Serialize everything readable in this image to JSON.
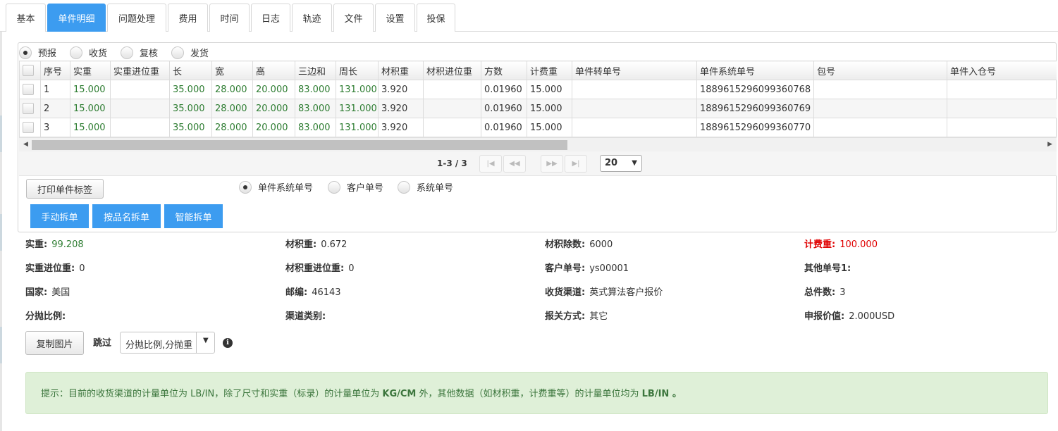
{
  "tabs": [
    "基本",
    "单件明细",
    "问题处理",
    "费用",
    "时间",
    "日志",
    "轨迹",
    "文件",
    "设置",
    "投保"
  ],
  "status_radios": [
    {
      "label": "预报",
      "checked": true
    },
    {
      "label": "收货",
      "checked": false
    },
    {
      "label": "复核",
      "checked": false
    },
    {
      "label": "发货",
      "checked": false
    }
  ],
  "table": {
    "columns": [
      "序号",
      "实重",
      "实重进位重",
      "长",
      "宽",
      "高",
      "三边和",
      "周长",
      "材积重",
      "材积进位重",
      "方数",
      "计费重",
      "单件转单号",
      "单件系统单号",
      "包号",
      "单件入仓号"
    ],
    "rows": [
      [
        "1",
        "15.000",
        "",
        "35.000",
        "28.000",
        "20.000",
        "83.000",
        "131.000",
        "3.920",
        "",
        "0.01960",
        "15.000",
        "",
        "1889615296099360768",
        "",
        ""
      ],
      [
        "2",
        "15.000",
        "",
        "35.000",
        "28.000",
        "20.000",
        "83.000",
        "131.000",
        "3.920",
        "",
        "0.01960",
        "15.000",
        "",
        "1889615296099360769",
        "",
        ""
      ],
      [
        "3",
        "15.000",
        "",
        "35.000",
        "28.000",
        "20.000",
        "83.000",
        "131.000",
        "3.920",
        "",
        "0.01960",
        "15.000",
        "",
        "1889615296099360770",
        "",
        ""
      ]
    ]
  },
  "pager": {
    "info": "1-3 / 3",
    "buttons": [
      "first",
      "prev",
      "next",
      "last"
    ],
    "page_size": "20"
  },
  "print_label_button": "打印单件标签",
  "label_type_radios": [
    {
      "label": "单件系统单号",
      "checked": true
    },
    {
      "label": "客户单号",
      "checked": false
    },
    {
      "label": "系统单号",
      "checked": false
    }
  ],
  "split_buttons": [
    "手动拆单",
    "按品名拆单",
    "智能拆单"
  ],
  "fields": [
    {
      "key": "实重:",
      "value": "99.208",
      "style": "green"
    },
    {
      "key": "材积重:",
      "value": "0.672",
      "style": ""
    },
    {
      "key": "材积除数:",
      "value": "6000",
      "style": ""
    },
    {
      "key": "计费重:",
      "value": "100.000",
      "style": "red"
    },
    {
      "key": "实重进位重:",
      "value": "0",
      "style": ""
    },
    {
      "key": "材积重进位重:",
      "value": "0",
      "style": ""
    },
    {
      "key": "客户单号:",
      "value": "ys00001",
      "style": ""
    },
    {
      "key": "其他单号1:",
      "value": "",
      "style": ""
    },
    {
      "key": "国家:",
      "value": "美国",
      "style": ""
    },
    {
      "key": "邮编:",
      "value": "46143",
      "style": ""
    },
    {
      "key": "收货渠道:",
      "value": "英式算法客户报价",
      "style": ""
    },
    {
      "key": "总件数:",
      "value": "3",
      "style": ""
    },
    {
      "key": "分抛比例:",
      "value": "",
      "style": ""
    },
    {
      "key": "渠道类别:",
      "value": "",
      "style": ""
    },
    {
      "key": "报关方式:",
      "value": "其它",
      "style": ""
    },
    {
      "key": "申报价值:",
      "value": "2.000USD",
      "style": ""
    }
  ],
  "copy_image_button": "复制图片",
  "skip_label": "跳过",
  "skip_select_value": "分抛比例,分抛重",
  "notice": {
    "prefix": "提示：目前的收货渠道的计量单位为 LB/IN，除了尺寸和实重（标录）的计量单位为 ",
    "unit1": "KG/CM",
    "middle": " 外，其他数据（如材积重，计费重等）的计量单位均为 ",
    "unit2": "LB/IN",
    "suffix": " 。"
  },
  "colors": {
    "accent": "#3c9cf0",
    "value_green": "#2e7d32",
    "alert_red": "#e00000",
    "notice_bg": "#dff0d8"
  }
}
